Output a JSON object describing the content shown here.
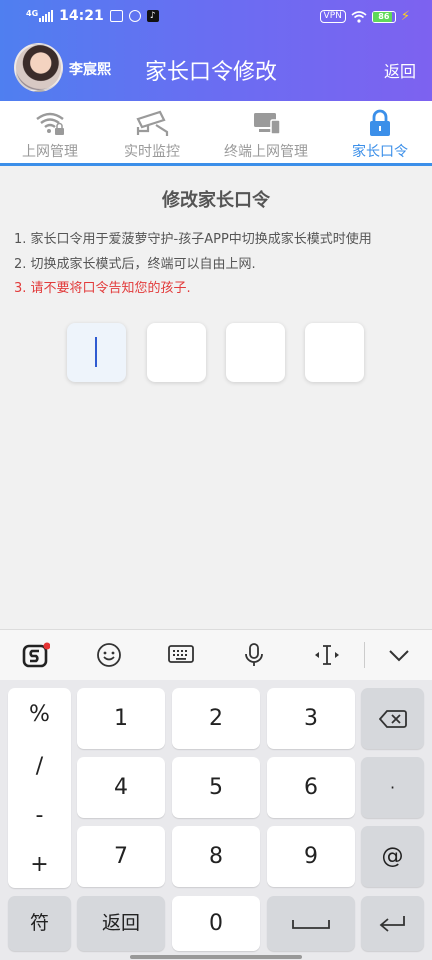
{
  "status_bar": {
    "time": "14:21",
    "network": "4G",
    "vpn": "VPN",
    "battery": "86"
  },
  "header": {
    "username": "李宸熙",
    "title": "家长口令修改",
    "back_label": "返回"
  },
  "tabs": [
    {
      "label": "上网管理",
      "icon": "wifi-lock-icon",
      "active": false
    },
    {
      "label": "实时监控",
      "icon": "camera-icon",
      "active": false
    },
    {
      "label": "终端上网管理",
      "icon": "devices-icon",
      "active": false
    },
    {
      "label": "家长口令",
      "icon": "lock-icon",
      "active": true
    }
  ],
  "form": {
    "title": "修改家长口令",
    "notes": [
      "1. 家长口令用于爱菠萝守护-孩子APP中切换成家长模式时使用",
      "2. 切换成家长模式后，终端可以自由上网.",
      "3. 请不要将口令告知您的孩子."
    ],
    "pin_boxes": [
      "",
      "",
      "",
      ""
    ]
  },
  "keyboard": {
    "toolbar": [
      "sogou-logo-icon",
      "emoji-icon",
      "keyboard-icon",
      "microphone-icon",
      "cursor-icon",
      "collapse-icon"
    ],
    "symbols": [
      "%",
      "/",
      "-",
      "+"
    ],
    "digits": [
      "1",
      "2",
      "3",
      "4",
      "5",
      "6",
      "7",
      "8",
      "9",
      "0"
    ],
    "dot": "·",
    "at": "@",
    "fu": "符",
    "back": "返回",
    "space": "⎵",
    "enter": "↵"
  },
  "colors": {
    "accent": "#3b8fe9",
    "header_start": "#4f7ff0",
    "header_end": "#7d62f0",
    "warning": "#e23b3b"
  }
}
